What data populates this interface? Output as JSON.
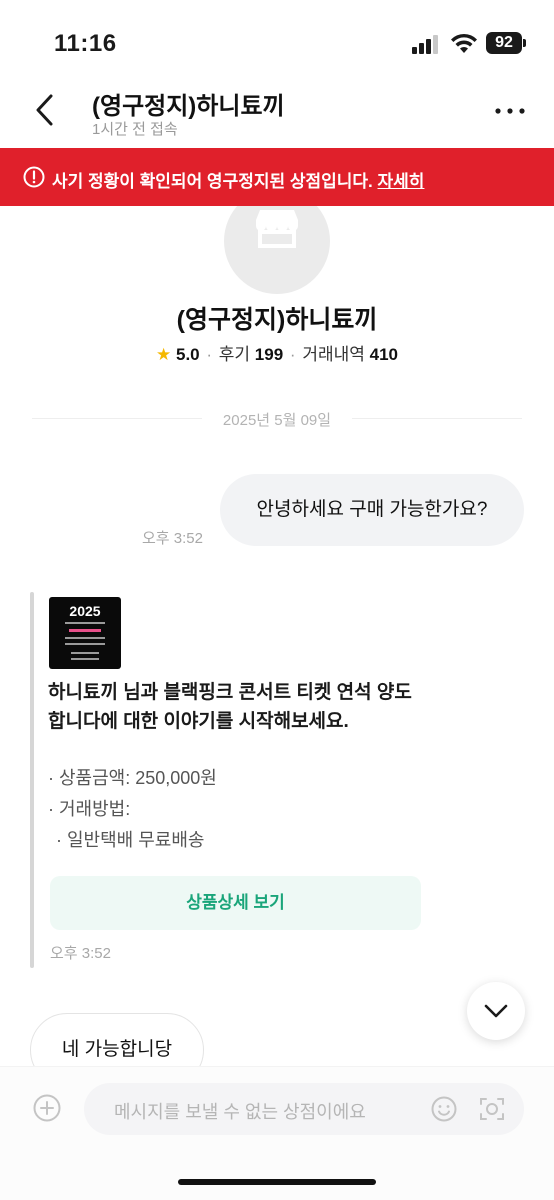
{
  "status_bar": {
    "time": "11:16",
    "battery": "92"
  },
  "header": {
    "title": "(영구정지)하니툐끼",
    "subtitle": "1시간 전 접속"
  },
  "banner": {
    "message": "사기 정황이 확인되어 영구정지된 상점입니다.",
    "link": "자세히",
    "color": "#e0202b"
  },
  "profile": {
    "name": "(영구정지)하니툐끼",
    "rating": "5.0",
    "reviews_label": "후기",
    "reviews_count": "199",
    "trades_label": "거래내역",
    "trades_count": "410",
    "avatar_icon": "store-icon"
  },
  "chat": {
    "date": "2025년 5월 09일",
    "messages": [
      {
        "side": "out",
        "text": "안녕하세요 구매 가능한가요?",
        "time": "오후 3:52"
      },
      {
        "side": "in",
        "type": "product_card",
        "thumbnail_title": "2025",
        "heading_line1": "하니툐끼 님과 블랙핑크 콘서트 티켓 연석 양도",
        "heading_line2": "합니다에 대한 이야기를 시작해보세요.",
        "price": "· 상품금액: 250,000원",
        "method_label": "· 거래방법:",
        "method_value": "· 일반택배 무료배송",
        "button": "상품상세 보기",
        "time": "오후 3:52"
      },
      {
        "side": "in",
        "text": "네 가능합니당"
      }
    ]
  },
  "input": {
    "placeholder": "메시지를 보낼 수 없는 상점이에요"
  },
  "colors": {
    "accent_green": "#1aa57a",
    "star": "#f5b800"
  }
}
